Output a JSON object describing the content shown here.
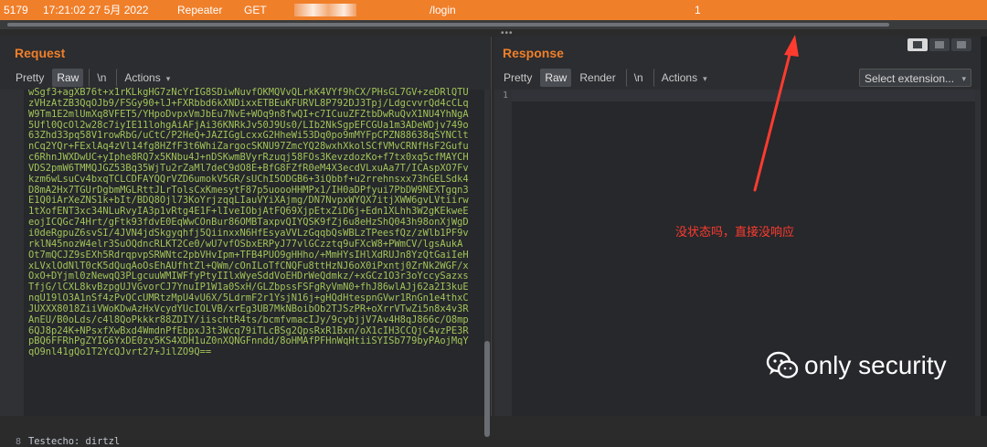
{
  "history_row": {
    "number": "5179",
    "time": "17:21:02 27 5月 2022",
    "tool": "Repeater",
    "method": "GET",
    "url": "/login",
    "status": "1"
  },
  "request": {
    "title": "Request",
    "tabs": [
      "Pretty",
      "Raw",
      "\\n",
      "Actions"
    ],
    "active_tab": "Raw",
    "body_lines": [
      "wSgf3+agXB76t+x1rKLkgHG7zNcYrIG8SDiwNuvfOKMQVvQLrkK4VYf9hCX/PHsGL7GV+zeDRlQTU",
      "zVHzAtZB3QqOJb9/FSGy90+lJ+FXRbbd6kXNDixxETBEuKFURVL8P792DJ3Tpj/LdgcvvrQd4cCLq",
      "W9Tm1E2mlUmXq8VFET5/YHpoDvpxVmJbEu7NvE+WOq9n8fwQI+c7ICuuZFZtbDwRuQvX1NU4YhNgA",
      "5Ufl0QcOl2w28c7iyIE11lohgAiAFjAi36KNRkJv50J9Us0/LIb2NkSgpEFCGUa1m3ADeWDjv749o",
      "63Zhd33pq58V1rowRbG/uCtC/P2HeQ+JAZIGgLcxxG2HheWi53Dq0po9mMYFpCPZN88638qSYNClt",
      "nCq2YQr+FExlAq4zVl14fg8HZfF3t6WhiZargocSKNU97ZmcYQ28wxhXkolSCfVMvCRNfHsF2Gufu",
      "c6RhnJWXDwUC+yIphe8RQ7x5KNbu4J+nDSKwmBVyrRzuqj58FOs3KevzdozKo+f7tx0xq5cfMAYCH",
      "VDS2pmW6TMMQJGZ53Bq35WjTu2rZaMl7deC9dO8E+BfG8FZfR0eM4X3ecdVLxuAa7T/ICAspXO7Fv",
      "kzm6wLsuCv4bxqTCLCDFAYQQrVZD6umokV5GR/sUChI5ODGB6+3iQbbf+u2rrehnsxx73hGELSdk4",
      "D8mA2Hx7TGUrDgbmMGLRttJLrTolsCxKmesytF87p5uoooHHMPx1/IH0aDPfyui7PbDW9NEXTgqn3",
      "E1Q0iArXeZNS1k+bIt/BDQ8Ojl73KoYrjzqqLIauVYiXAjmg/DN7NvpxWYQX7itjXWW6gvLVtiirw",
      "1tXofENT3xc34NLuRvyIA3p1vRtg4E1F+lIveIObjAtFQ69XjpEtxZiD6j+Edn1XLhh3W2gKEkweE",
      "eojICQGc74Hrt/gFtk93fdvE0EqWwCOnBur86OMBTaxpvQIYQSK9fZj6u8eHzShQ043h98onXjWgD",
      "i0deRgpuZ6svSI/4JVN4jdSkgyqhfj5QiinxxN6HfEsyaVVLzGqqbQsWBLzTPeesfQz/zWlb1PF9v",
      "rklN45nozW4elr3SuOQdncRLKT2Ce0/wU7vfOSbxERPyJ77vlGCzztq9uFXcW8+PWmCV/lgsAukA",
      "Ot7mQCJZ9sEXh5RdrqpvpSRWNtc2pbVHvIpm+TFB4PUO9gHHho/+MmHYsIHlXdRUJn8YzQtGaiIeH",
      "xLVxlOdNlT0cK5dQuqAoOsEhAUfhtZl+QWm/cOnILoTfCNQFu8ttHzNJ6oX0iPxntj0ZrNk2WGF/x",
      "OxO+DYjml0zNewqQ3PLgcuuWMIWFfyPtyIIlxWyeSddVoEHDrWeQdmkz/+xGCz1O3r3oYccySazxs",
      "TfjG/lCXL8kvBzpgUJVGvorCJ7YnuIP1W1a0SxH/GLZbpssFSFgRyVmN0+fhJ86wlAJj62a2I3kuE",
      "nqU19lO3A1nSf4zPvQCcUMRtzMpU4vU6X/5LdrmF2r1YsjN16j+gHQdHtespnGVwr1RnGn1e4thxC",
      "JUXXX8018ZiiVWoKDwAzHxVcydYUcIOLVB/xrEg3UB7MkNBoibOb2TJSzPR+oXrrVTwZi5n8x4v3R",
      "AnEU/B0oLds/c4l8QoPkkkr88ZDIY/iischtR4ts/bcmfvmacIJy/9cybjjV7Av4H8qJ866c/O8mp",
      "6QJ8p24K+NPsxfXwBxd4WmdnPfEbpxJ3t3Wcq79iTLcBSg2QpsRxR1Bxn/oX1cIH3CCQjC4vzPE3R",
      "pBQ6FFRhPgZYIG6YxDE0zv5KS4XDH1uZ0nXQNGFnndd/8oHMAfPFHnWqHtiiSYISb779byPAojMqY",
      "qO9nl41gQo1T2YcQJvrt27+JilZO9Q=="
    ],
    "last_line_number": "8",
    "last_line": "Testecho: dirtzl"
  },
  "response": {
    "title": "Response",
    "tabs": [
      "Pretty",
      "Raw",
      "Render",
      "\\n",
      "Actions"
    ],
    "active_tab": "Raw",
    "line_number": "1",
    "extension_select": "Select extension..."
  },
  "annotation": {
    "text": "没状态吗，直接没响应",
    "color": "#ff3b2f"
  },
  "watermark": {
    "text": "only security"
  },
  "colors": {
    "accent": "#f07f2a",
    "code_green": "#a3c45a"
  }
}
